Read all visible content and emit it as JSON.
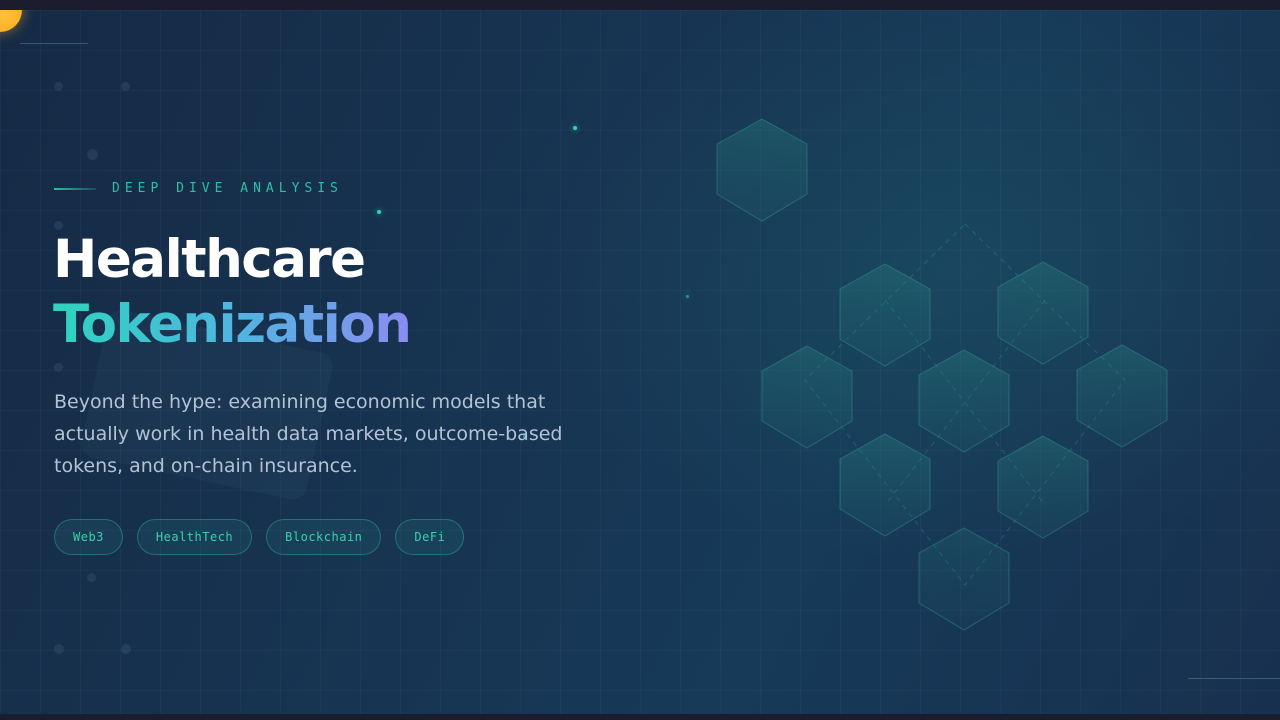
{
  "hero": {
    "eyebrow": "DEEP DIVE ANALYSIS",
    "title_line1": "Healthcare",
    "title_line2": "Tokenization",
    "subtitle": "Beyond the hype: examining economic models that actually work in health data markets, outcome-based tokens, and on-chain insurance.",
    "tags": [
      {
        "label": "Web3"
      },
      {
        "label": "HealthTech"
      },
      {
        "label": "Blockchain"
      },
      {
        "label": "DeFi"
      }
    ]
  },
  "colors": {
    "background": "#173553",
    "accent_teal": "#2fbfa3",
    "title_gradient_start": "#2dd4bf",
    "title_gradient_end": "#8b8cf0",
    "orb": "#f59e0b",
    "text_muted": "#b4c2d4"
  },
  "decorations": {
    "hex_cluster_icon": "hexagon-network-icon",
    "orb_icon": "glowing-orb"
  }
}
